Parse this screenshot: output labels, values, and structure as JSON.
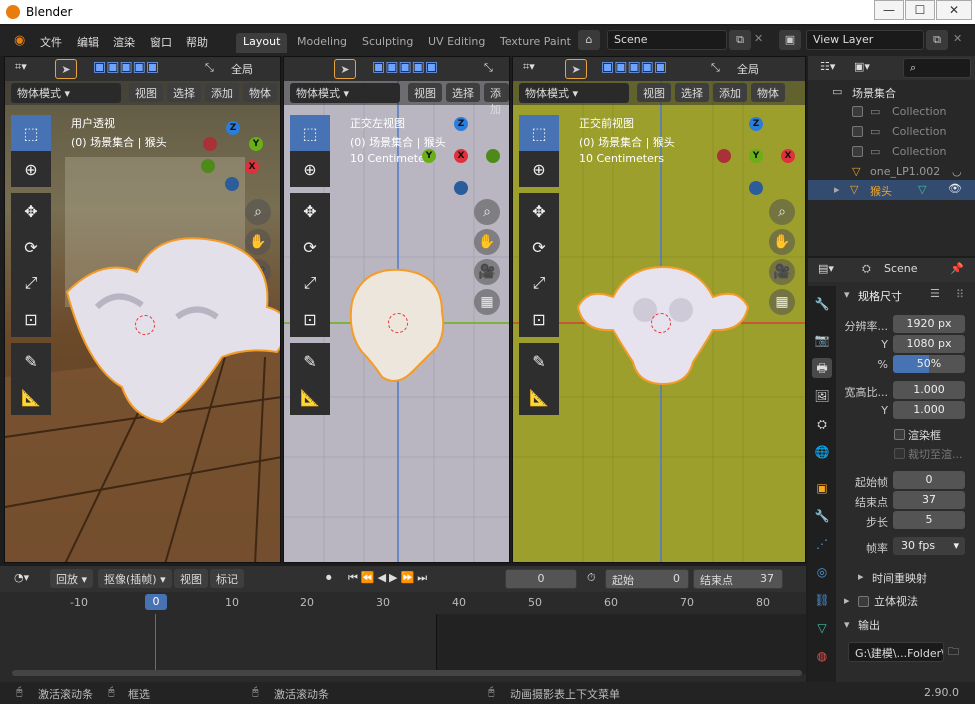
{
  "app": {
    "title": "Blender",
    "version": "2.90.0"
  },
  "menu": [
    "文件",
    "编辑",
    "渲染",
    "窗口",
    "帮助"
  ],
  "workspaces": [
    "Layout",
    "Modeling",
    "Sculpting",
    "UV Editing",
    "Texture Paint"
  ],
  "scene": {
    "name": "Scene",
    "view_layer": "View Layer"
  },
  "viewport_header": {
    "mode": "物体模式",
    "view": "视图",
    "select": "选择",
    "add": "添加",
    "object": "物体",
    "orientation": "全局"
  },
  "viewports": [
    {
      "name": "用户透视",
      "collection": "(0) 场景集合 | 猴头",
      "scale": ""
    },
    {
      "name": "正交左视图",
      "collection": "(0) 场景集合 | 猴头",
      "scale": "10 Centimeters"
    },
    {
      "name": "正交前视图",
      "collection": "(0) 场景集合 | 猴头",
      "scale": "10 Centimeters"
    }
  ],
  "gizmo": {
    "x": "X",
    "y": "Y",
    "z": "Z"
  },
  "timeline": {
    "playback": "回放",
    "keying": "抠像(插帧)",
    "view": "视图",
    "marker": "标记",
    "current_frame": "0",
    "start_label": "起始",
    "start": "0",
    "end_label": "结束点",
    "end": "37",
    "ticks": [
      "-10",
      "0",
      "10",
      "20",
      "30",
      "40",
      "50",
      "60",
      "70",
      "80"
    ]
  },
  "status": {
    "left_a": "激活滚动条",
    "left_b": "框选",
    "middle": "激活滚动条",
    "right": "动画摄影表上下文菜单"
  },
  "outliner": {
    "root": "场景集合",
    "items": [
      "Collection",
      "Collection",
      "Collection",
      "one_LP1.002",
      "猴头"
    ]
  },
  "properties": {
    "scene": "Scene",
    "panel": "规格尺寸",
    "res_label": "分辨率...",
    "res_x": "1920 px",
    "y_label": "Y",
    "res_y": "1080 px",
    "pct_label": "%",
    "pct": "50%",
    "aspect_label": "宽高比...",
    "aspect_x": "1.000",
    "aspect_y": "1.000",
    "border_label": "渲染框",
    "crop_label": "裁切至渲...",
    "frame_start_label": "起始帧",
    "frame_start": "0",
    "frame_end_label": "结束点",
    "frame_end": "37",
    "step_label": "步长",
    "step": "5",
    "fps_label": "帧率",
    "fps": "30 fps",
    "time_remap": "时间重映射",
    "stereo": "立体视法",
    "output": "输出",
    "path": "G:\\建模\\...Folder\\"
  },
  "colors": {
    "accent": "#4772b3",
    "orange": "#f5a623",
    "x": "#e0303c",
    "y": "#6aae18",
    "z": "#2b7ddc",
    "front_bg": "#9d9f2c",
    "side_bg": "#b9b6c2"
  }
}
